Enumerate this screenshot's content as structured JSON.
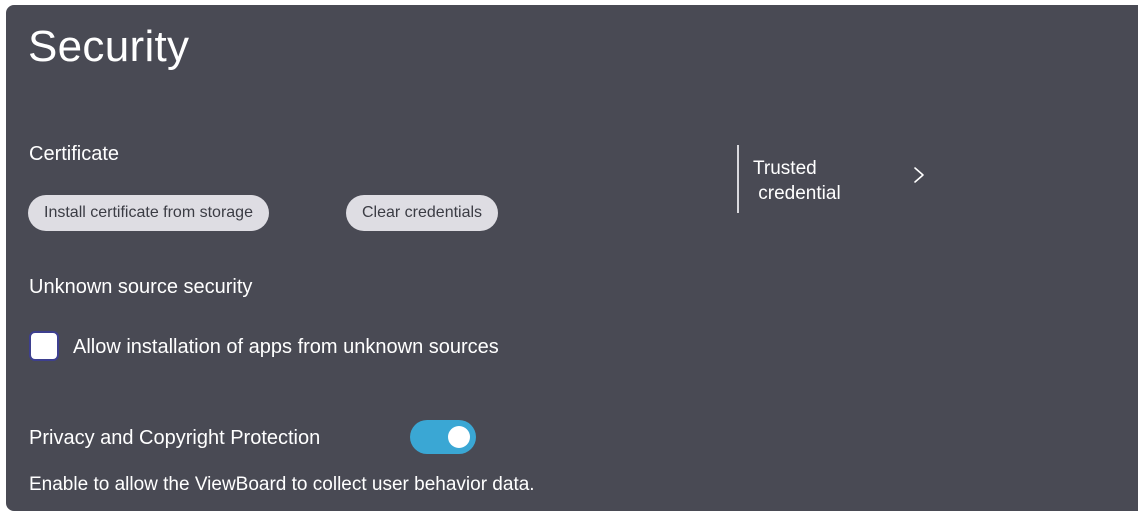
{
  "page": {
    "title": "Security"
  },
  "certificate": {
    "heading": "Certificate",
    "install_label": "Install certificate from storage",
    "clear_label": "Clear credentials",
    "trusted_label": "Trusted\n credential",
    "trusted_icon": "chevron-right-icon"
  },
  "unknown_source": {
    "heading": "Unknown source security",
    "checkbox_label": "Allow installation of apps from unknown sources",
    "checked": false
  },
  "privacy": {
    "heading": "Privacy and Copyright Protection",
    "toggle_on": true,
    "description": "Enable to allow the ViewBoard to collect user behavior data."
  },
  "colors": {
    "panel_bg": "#494a54",
    "pill_bg": "#dedde3",
    "toggle_on": "#3aa7d4"
  }
}
